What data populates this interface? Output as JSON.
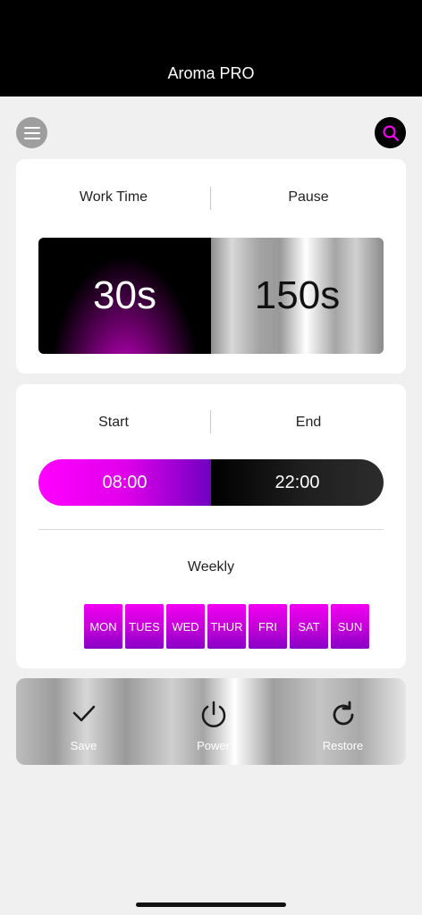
{
  "app": {
    "title": "Aroma PRO"
  },
  "header": {
    "menu_icon": "hamburger-menu-icon",
    "search_icon": "search-icon",
    "accent": "#ff00ff"
  },
  "timer": {
    "work_time_label": "Work Time",
    "pause_label": "Pause",
    "work_time_value": "30s",
    "pause_value": "150s"
  },
  "schedule": {
    "start_label": "Start",
    "end_label": "End",
    "start_value": "08:00",
    "end_value": "22:00",
    "weekly_label": "Weekly",
    "days": [
      "MON",
      "TUES",
      "WED",
      "THUR",
      "FRI",
      "SAT",
      "SUN"
    ]
  },
  "actions": {
    "save_label": "Save",
    "power_label": "Power",
    "restore_label": "Restore"
  }
}
